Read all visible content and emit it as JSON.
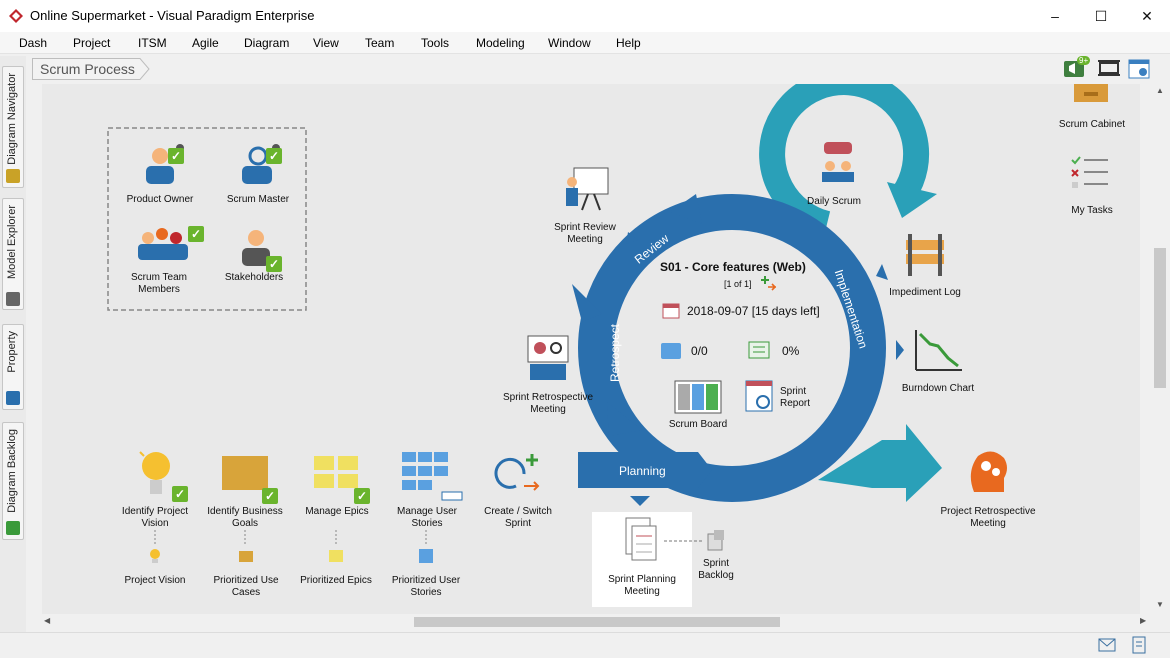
{
  "window": {
    "title": "Online Supermarket - Visual Paradigm Enterprise",
    "minimize": "–",
    "maximize": "☐",
    "close": "✕"
  },
  "menu": [
    "Dash",
    "Project",
    "ITSM",
    "Agile",
    "Diagram",
    "View",
    "Team",
    "Tools",
    "Modeling",
    "Window",
    "Help"
  ],
  "left_tabs": [
    "Diagram Navigator",
    "Model Explorer",
    "Property",
    "Diagram Backlog"
  ],
  "breadcrumb": "Scrum Process",
  "notification_badge": "9+",
  "roles": {
    "product_owner": "Product Owner",
    "scrum_master": "Scrum Master",
    "scrum_team": "Scrum Team Members",
    "stakeholders": "Stakeholders"
  },
  "side_tools": {
    "scrum_cabinet": "Scrum Cabinet",
    "my_tasks": "My Tasks"
  },
  "cycle": {
    "review": "Review",
    "implementation": "Implementation",
    "retrospect": "Retrospect",
    "planning": "Planning",
    "sprint_title": "S01 - Core features (Web)",
    "sprint_counter": "[1 of 1]",
    "date": "2018-09-07 [15 days left]",
    "points": "0/0",
    "progress": "0%",
    "scrum_board": "Scrum Board",
    "sprint_report": "Sprint Report"
  },
  "meetings": {
    "sprint_review": "Sprint Review Meeting",
    "daily_scrum": "Daily Scrum",
    "impediment_log": "Impediment Log",
    "burndown": "Burndown Chart",
    "sprint_retro": "Sprint Retrospective Meeting",
    "project_retro": "Project Retrospective Meeting",
    "sprint_planning": "Sprint Planning Meeting",
    "sprint_backlog": "Sprint Backlog"
  },
  "steps": {
    "identify_vision": "Identify Project Vision",
    "identify_goals": "Identify Business Goals",
    "manage_epics": "Manage Epics",
    "manage_stories": "Manage User Stories",
    "create_sprint": "Create / Switch Sprint",
    "project_vision": "Project Vision",
    "prioritized_use_cases": "Prioritized Use Cases",
    "prioritized_epics": "Prioritized Epics",
    "prioritized_stories": "Prioritized User Stories"
  },
  "colors": {
    "arrow_blue": "#2a6fad",
    "teal": "#2aa0b8",
    "check_green": "#6ab42d",
    "orange": "#e8691f"
  }
}
